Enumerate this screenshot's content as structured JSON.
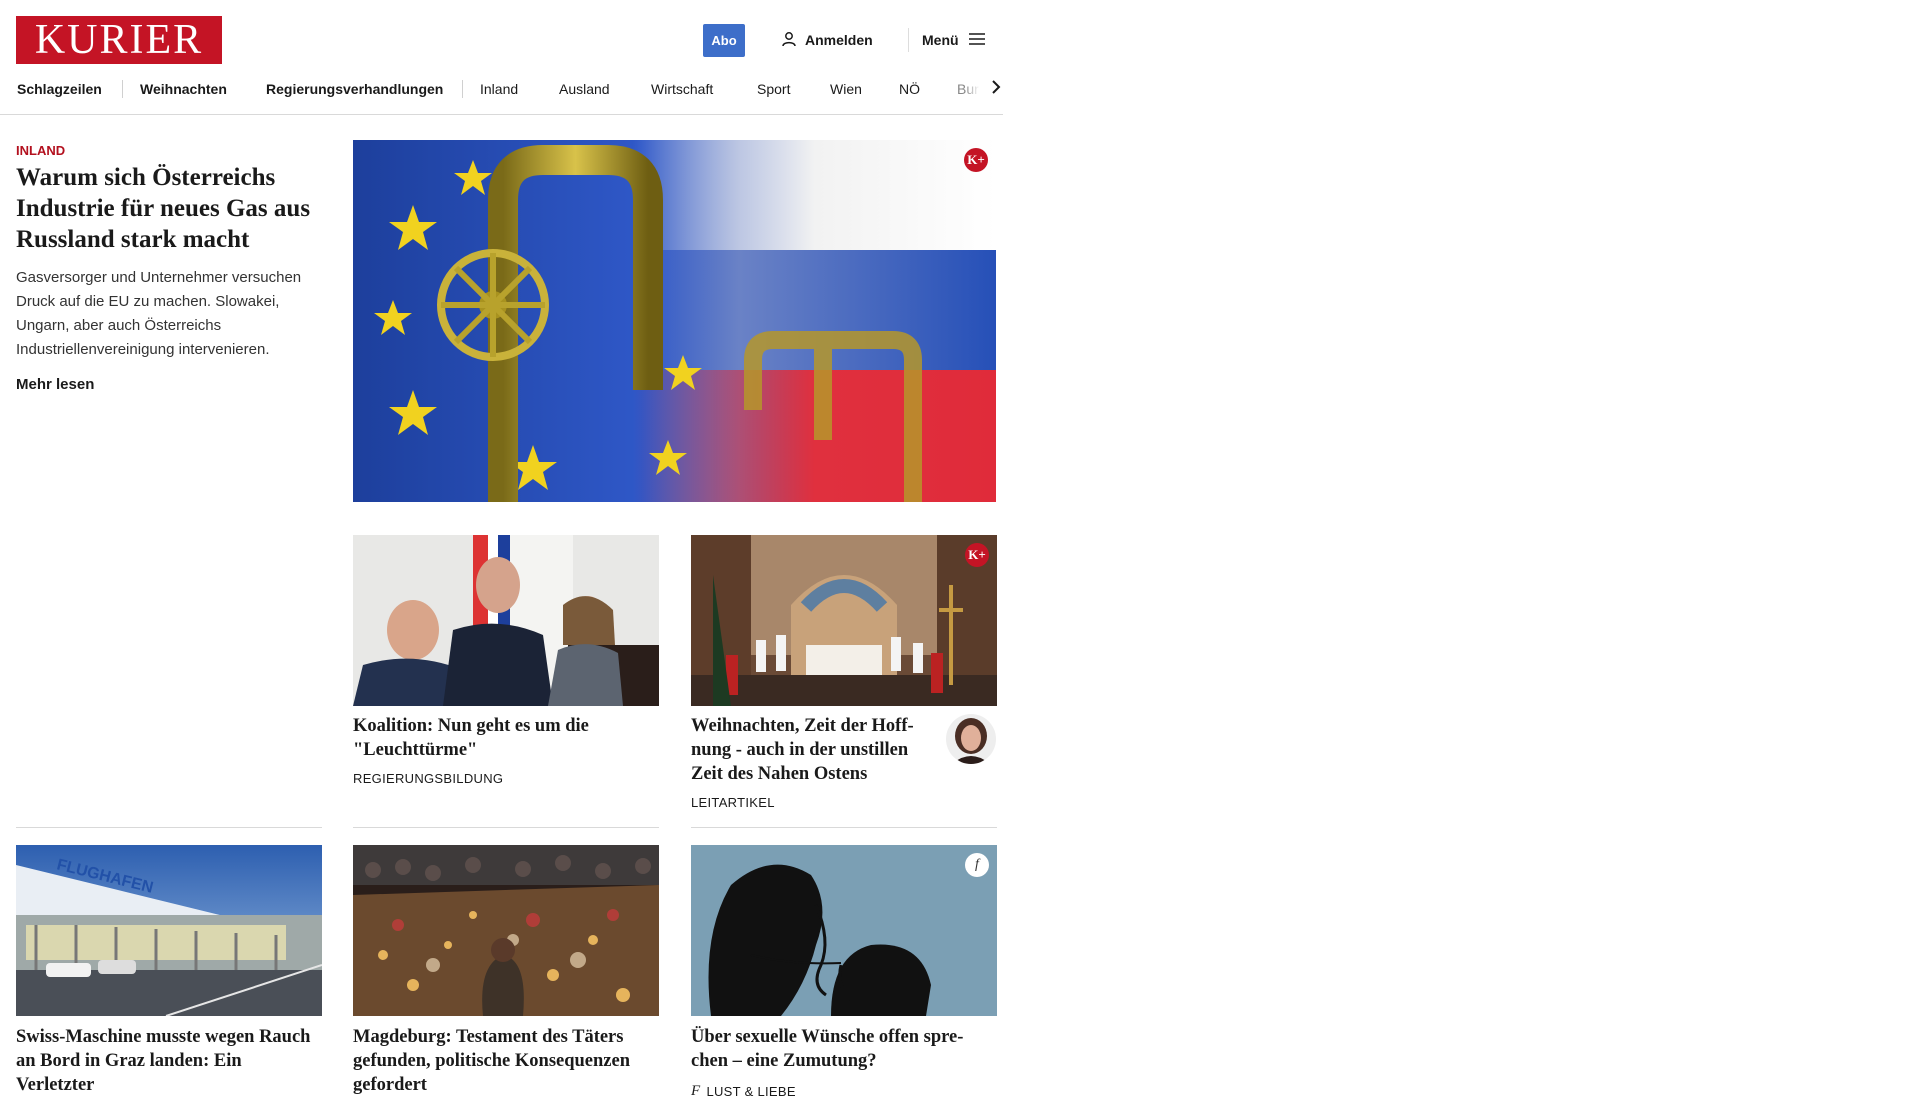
{
  "header": {
    "logo_text": "KURIER",
    "abo_label": "Abo",
    "login_label": "Anmelden",
    "menu_label": "Menü"
  },
  "nav": {
    "items": [
      "Schlagzeilen",
      "Weihnachten",
      "Regierungsverhandlungen",
      "Inland",
      "Ausland",
      "Wirtschaft",
      "Sport",
      "Wien",
      "NÖ",
      "Bur"
    ]
  },
  "lead": {
    "kicker": "INLAND",
    "title": "Warum sich Österreichs Industrie für neues Gas aus Russland stark macht",
    "description": "Gasversorger und Unternehmer versuchen Druck auf die EU zu machen. Slowakei, Ungarn, aber auch Österreichs Industriellenvereinigung intervenieren.",
    "more_label": "Mehr lesen",
    "badge": "K+"
  },
  "cards": [
    {
      "title": "Koalition: Nun geht es um die \"Leuchttürme\"",
      "tag": "REGIERUNGSBILDUNG"
    },
    {
      "title": "Weihnachten, Zeit der Hoff-nung - auch in der unstillen Zeit des Nahen Ostens",
      "tag": "LEITARTIKEL",
      "badge": "K+"
    },
    {
      "title": "Swiss-Maschine musste wegen Rauch an Bord in Graz landen: Ein Verletzter",
      "sign_text": "FLUGHAFEN"
    },
    {
      "title": "Magdeburg: Testament des Täters gefunden, politische Konsequenzen gefordert"
    },
    {
      "title": "Über sexuelle Wünsche offen spre-chen – eine Zumutung?",
      "tag": "LUST & LIEBE",
      "badge": "f"
    }
  ],
  "colors": {
    "brand": "#c41425",
    "abo": "#3d6ec9",
    "kicker": "#b3101e"
  }
}
